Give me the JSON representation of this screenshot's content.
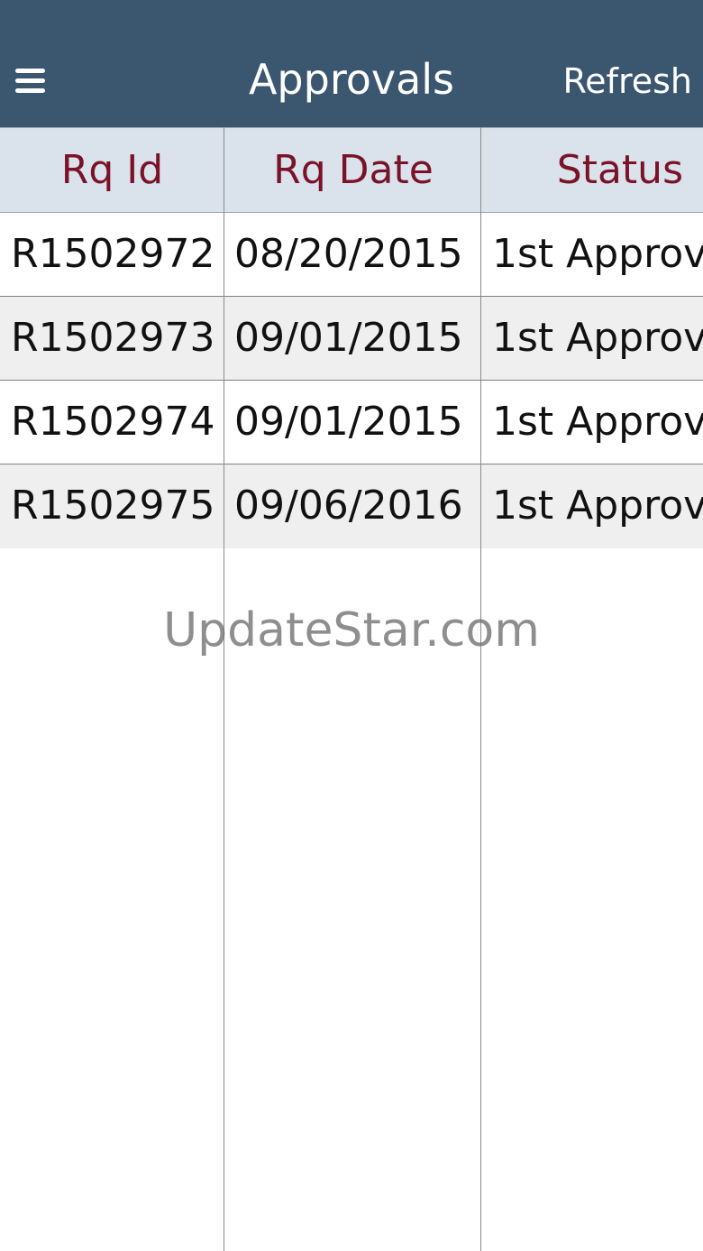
{
  "navbar": {
    "title": "Approvals",
    "refresh_label": "Refresh",
    "menu_icon": "hamburger-menu-icon"
  },
  "table": {
    "columns": [
      "Rq Id",
      "Rq Date",
      "Status"
    ],
    "rows": [
      {
        "id": "R1502972",
        "date": "08/20/2015",
        "status": "1st Approv"
      },
      {
        "id": "R1502973",
        "date": "09/01/2015",
        "status": "1st Approv"
      },
      {
        "id": "R1502974",
        "date": "09/01/2015",
        "status": "1st Approv"
      },
      {
        "id": "R1502975",
        "date": "09/06/2016",
        "status": "1st Approv"
      }
    ]
  },
  "watermark": "UpdateStar.com",
  "colors": {
    "navbar": "#3b566f",
    "header_background": "#dae2ec",
    "header_text": "#7a1228",
    "row_alt": "#efefef"
  }
}
